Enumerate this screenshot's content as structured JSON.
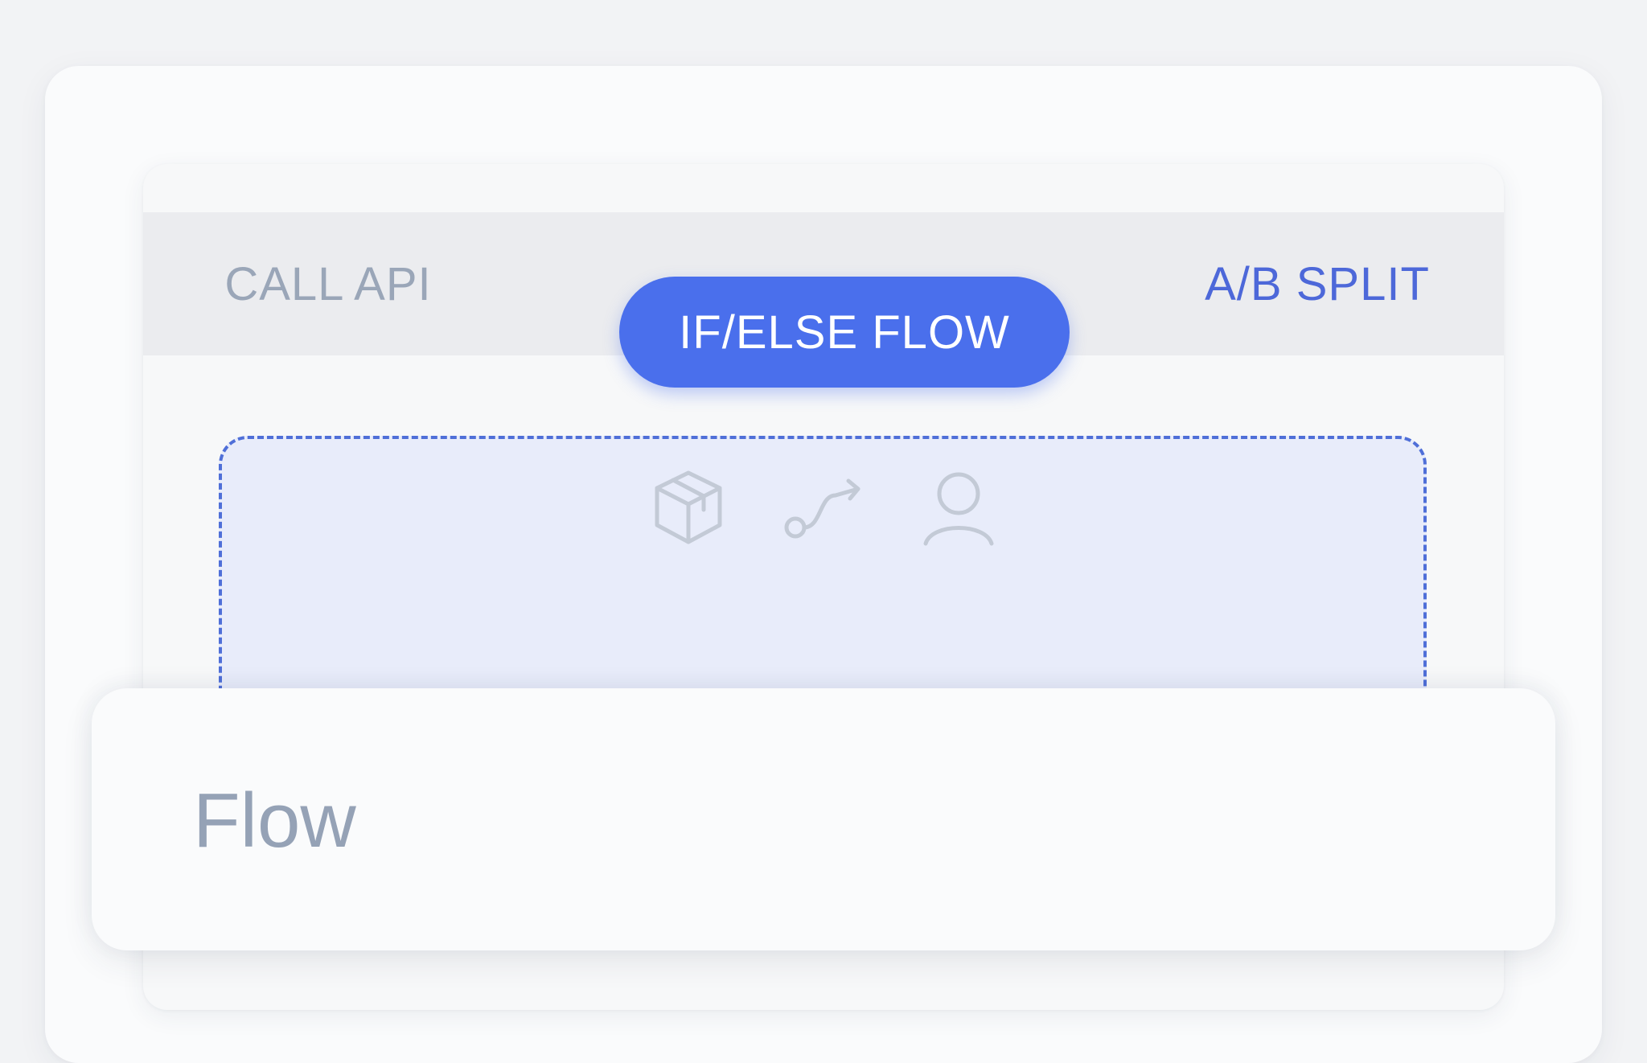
{
  "tabs": {
    "call_api": "CALL API",
    "if_else_flow": "IF/ELSE FLOW",
    "ab_split": "A/B SPLIT"
  },
  "drop_zone": {
    "icons": [
      "box-icon",
      "flow-path-icon",
      "user-icon"
    ]
  },
  "card": {
    "title": "Flow"
  },
  "colors": {
    "accent": "#4a6fec",
    "tab_inactive": "#9aa6b8",
    "tab_link": "#4d68d9",
    "drop_zone_border": "#4f6fd8",
    "drop_zone_fill": "#e8ecfa",
    "icon_color": "#c3cad6"
  }
}
